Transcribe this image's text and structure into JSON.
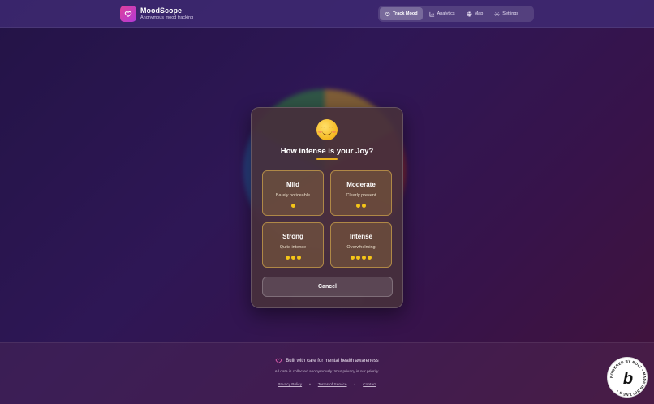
{
  "header": {
    "brand_name": "MoodScope",
    "brand_sub": "Anonymous mood tracking",
    "nav": [
      {
        "label": "Track Mood",
        "icon": "heart-icon",
        "active": true
      },
      {
        "label": "Analytics",
        "icon": "chart-icon",
        "active": false
      },
      {
        "label": "Map",
        "icon": "globe-icon",
        "active": false
      },
      {
        "label": "Settings",
        "icon": "gear-icon",
        "active": false
      }
    ]
  },
  "modal": {
    "emoji": "smiling-face-icon",
    "title": "How intense is your Joy?",
    "options": [
      {
        "title": "Mild",
        "subtitle": "Barely noticeable",
        "level": 1
      },
      {
        "title": "Moderate",
        "subtitle": "Clearly present",
        "level": 2
      },
      {
        "title": "Strong",
        "subtitle": "Quite intense",
        "level": 3
      },
      {
        "title": "Intense",
        "subtitle": "Overwhelming",
        "level": 4
      }
    ],
    "cancel_label": "Cancel"
  },
  "footer": {
    "main": "Built with care for mental health awareness",
    "note": "All data is collected anonymously. Your privacy is our priority.",
    "links": [
      "Privacy Policy",
      "Terms of Service",
      "Contact"
    ],
    "separator": "•"
  },
  "badge": {
    "ring_text": "POWERED BY BOLT • MADE IN BOLT.NEW •",
    "letter": "b"
  },
  "colors": {
    "accent": "#f5c518",
    "logo_gradient_start": "#e0409a",
    "logo_gradient_end": "#b03ad8"
  }
}
